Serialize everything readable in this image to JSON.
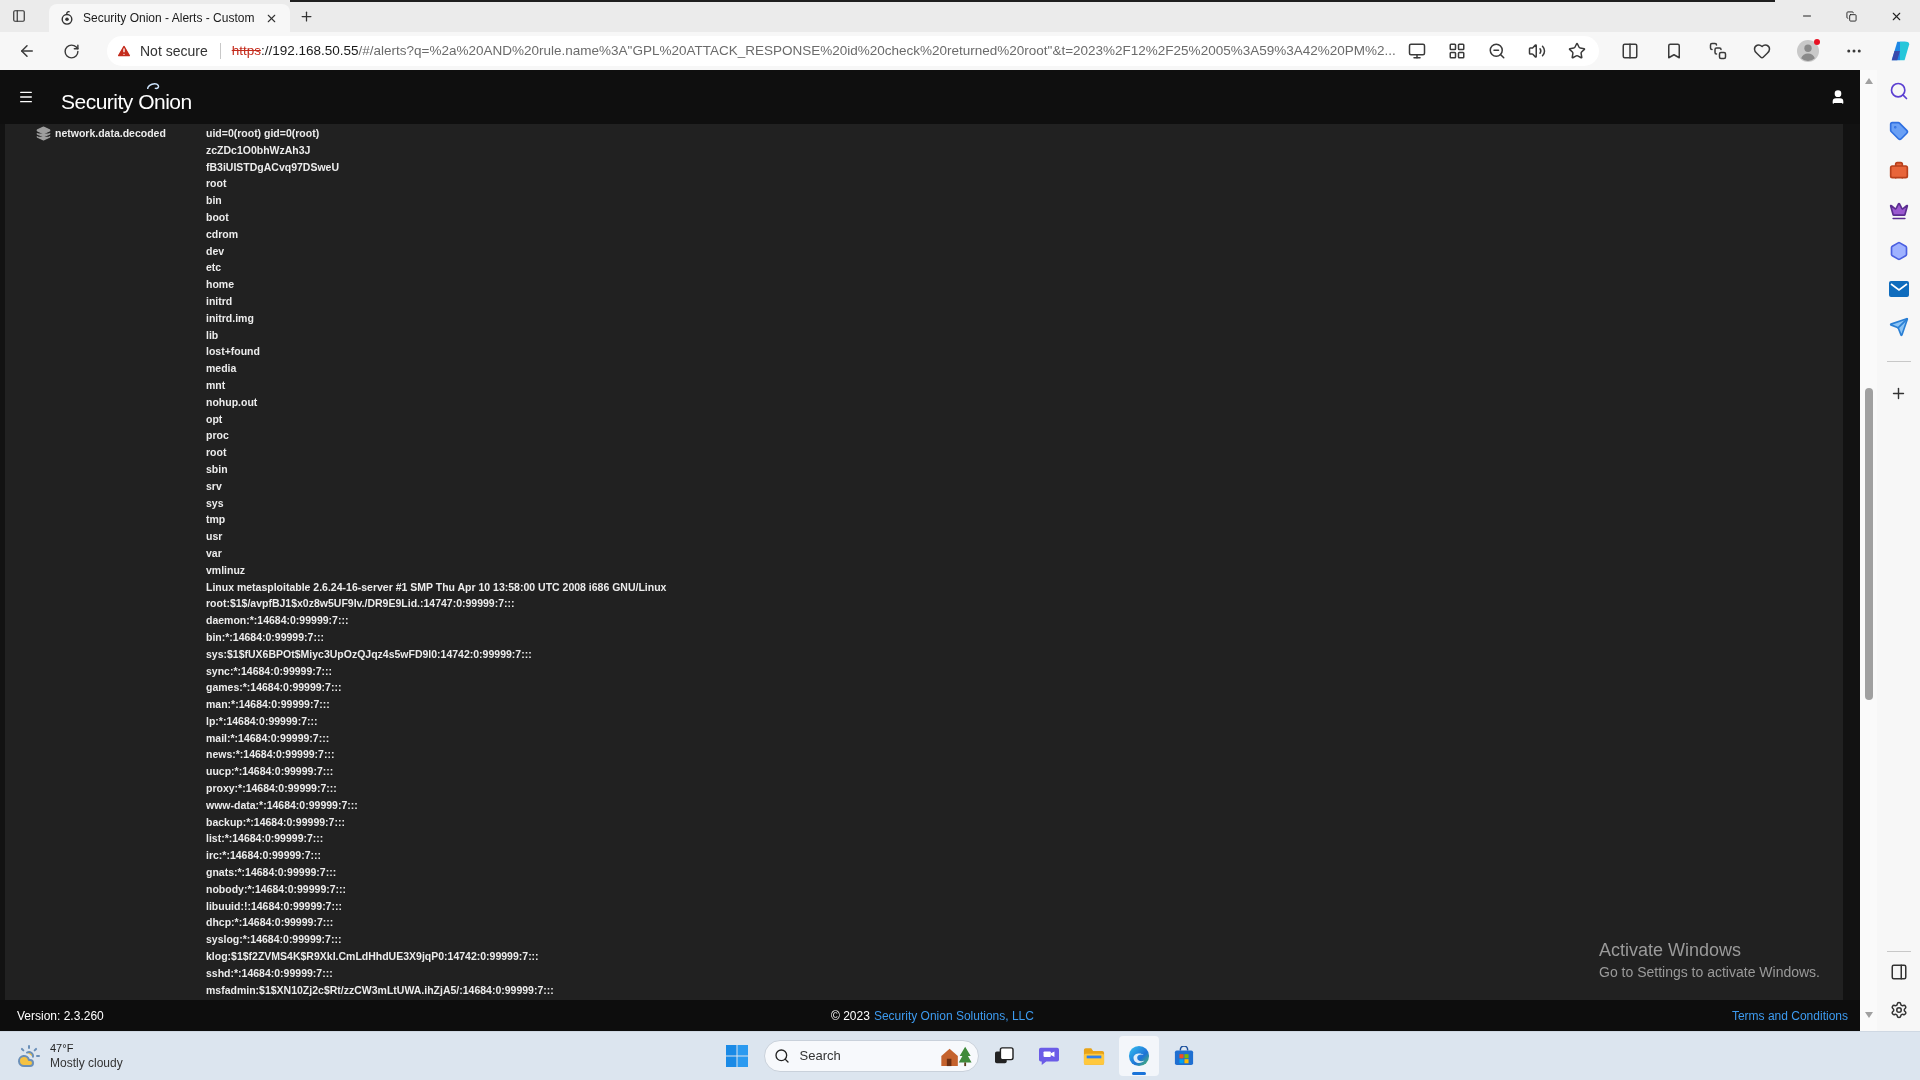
{
  "browser": {
    "tabs": [
      {
        "title": "Security Onion - Alerts - Custom",
        "selected": true
      }
    ],
    "security_label": "Not secure",
    "url": {
      "scheme": "https",
      "host": "://192.168.50.55",
      "path": "/#/alerts?q=%2a%20AND%20rule.name%3A\"GPL%20ATTACK_RESPONSE%20id%20check%20returned%20root\"&t=2023%2F12%2F25%2005%3A59%3A42%20PM%2..."
    }
  },
  "app": {
    "logo": "Security Onion"
  },
  "detail": {
    "field": "network.data.decoded",
    "lines": [
      "uid=0(root) gid=0(root)",
      "zcZDc1O0bhWzAh3J",
      "fB3iUISTDgACvq97DSweU",
      "root",
      "bin",
      "boot",
      "cdrom",
      "dev",
      "etc",
      "home",
      "initrd",
      "initrd.img",
      "lib",
      "lost+found",
      "media",
      "mnt",
      "nohup.out",
      "opt",
      "proc",
      "root",
      "sbin",
      "srv",
      "sys",
      "tmp",
      "usr",
      "var",
      "vmlinuz",
      "Linux metasploitable 2.6.24-16-server #1 SMP Thu Apr 10 13:58:00 UTC 2008 i686 GNU/Linux",
      "root:$1$/avpfBJ1$x0z8w5UF9Iv./DR9E9Lid.:14747:0:99999:7:::",
      "daemon:*:14684:0:99999:7:::",
      "bin:*:14684:0:99999:7:::",
      "sys:$1$fUX6BPOt$Miyc3UpOzQJqz4s5wFD9l0:14742:0:99999:7:::",
      "sync:*:14684:0:99999:7:::",
      "games:*:14684:0:99999:7:::",
      "man:*:14684:0:99999:7:::",
      "lp:*:14684:0:99999:7:::",
      "mail:*:14684:0:99999:7:::",
      "news:*:14684:0:99999:7:::",
      "uucp:*:14684:0:99999:7:::",
      "proxy:*:14684:0:99999:7:::",
      "www-data:*:14684:0:99999:7:::",
      "backup:*:14684:0:99999:7:::",
      "list:*:14684:0:99999:7:::",
      "irc:*:14684:0:99999:7:::",
      "gnats:*:14684:0:99999:7:::",
      "nobody:*:14684:0:99999:7:::",
      "libuuid:!:14684:0:99999:7:::",
      "dhcp:*:14684:0:99999:7:::",
      "syslog:*:14684:0:99999:7:::",
      "klog:$1$f2ZVMS4K$R9XkI.CmLdHhdUE3X9jqP0:14742:0:99999:7:::",
      "sshd:*:14684:0:99999:7:::",
      "msfadmin:$1$XN10Zj2c$Rt/zzCW3mLtUWA.ihZjA5/:14684:0:99999:7:::"
    ]
  },
  "footer": {
    "version": "Version: 2.3.260",
    "copyright": "© 2023",
    "company_link": "Security Onion Solutions, LLC",
    "terms_link": "Terms and Conditions"
  },
  "activation_notice": {
    "title": "Activate Windows",
    "message": "Go to Settings to activate Windows."
  },
  "taskbar": {
    "weather": {
      "temperature": "47°F",
      "condition": "Mostly cloudy"
    },
    "search": {
      "placeholder": "Search"
    },
    "apps": [
      {
        "kind": "task-view",
        "active": false
      },
      {
        "kind": "chat",
        "active": false
      },
      {
        "kind": "files",
        "active": false
      },
      {
        "kind": "browser",
        "active": true
      },
      {
        "kind": "store",
        "active": false
      }
    ]
  }
}
